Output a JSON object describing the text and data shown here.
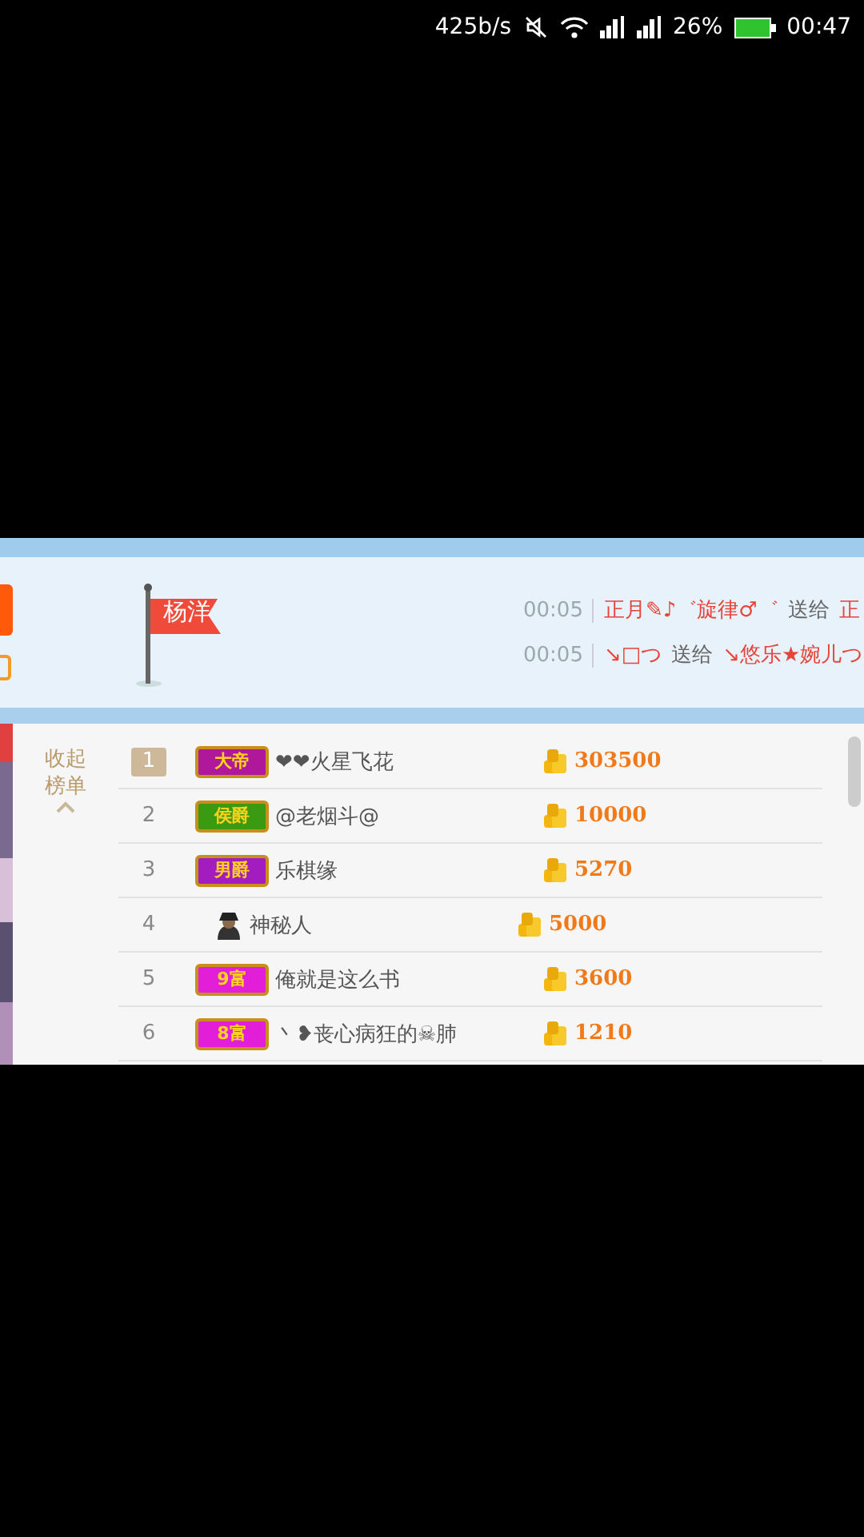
{
  "status_bar": {
    "speed": "425b/s",
    "battery": "26%",
    "time": "00:47"
  },
  "banner": {
    "anchor_flag": "杨洋",
    "gifts": [
      {
        "time": "00:05",
        "sender": "正月✎♪゛旋律♂゛",
        "verb": "送给",
        "receiver": "正"
      },
      {
        "time": "00:05",
        "sender": "↘□つ",
        "verb": "送给",
        "receiver": "↘悠乐★婉儿つ"
      }
    ]
  },
  "ranking": {
    "collapse": "收起榜单",
    "rows": [
      {
        "rank": "1",
        "top": true,
        "kind": "badge",
        "badge": "大帝",
        "color": "#b0189c",
        "name": "❤❤火星飞花",
        "coins": "303500"
      },
      {
        "rank": "2",
        "top": false,
        "kind": "badge",
        "badge": "侯爵",
        "color": "#3a9a12",
        "name": "@老烟斗@",
        "coins": "10000"
      },
      {
        "rank": "3",
        "top": false,
        "kind": "badge",
        "badge": "男爵",
        "color": "#a21cc0",
        "name": "乐棋缘",
        "coins": "5270"
      },
      {
        "rank": "4",
        "top": false,
        "kind": "mystery",
        "name": "神秘人",
        "coins": "5000"
      },
      {
        "rank": "5",
        "top": false,
        "kind": "badge",
        "badge": "9富",
        "color": "#e21ed8",
        "name": "俺就是这么书",
        "coins": "3600"
      },
      {
        "rank": "6",
        "top": false,
        "kind": "badge",
        "badge": "8富",
        "color": "#e21ed8",
        "name": "丶❥丧心病狂的☠肺",
        "coins": "1210"
      }
    ]
  }
}
